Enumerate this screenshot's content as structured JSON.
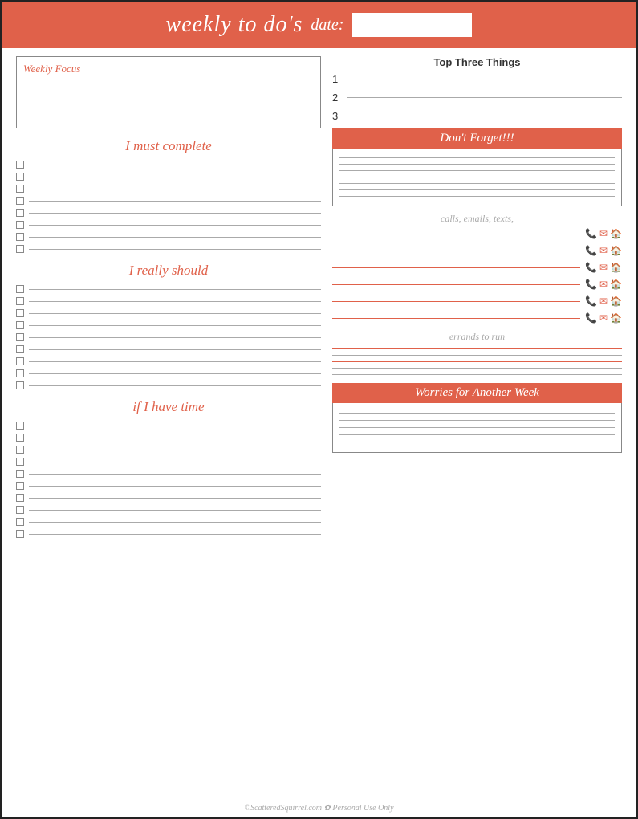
{
  "header": {
    "title": "weekly to do's",
    "date_label": "date:",
    "date_placeholder": ""
  },
  "left": {
    "weekly_focus_label": "Weekly Focus",
    "section1_label": "I must complete",
    "section2_label": "I really should",
    "section3_label": "if I have time",
    "must_complete_count": 8,
    "really_should_count": 9,
    "if_have_time_count": 10
  },
  "right": {
    "top_three_title": "Top Three Things",
    "top_three_items": [
      "1",
      "2",
      "3"
    ],
    "dont_forget_title": "Don't Forget!!!",
    "dont_forget_lines": 7,
    "calls_label": "calls, emails, texts,",
    "calls_rows": 6,
    "errands_label": "errands to run",
    "errand_rows": 5,
    "worries_title": "Worries for Another Week",
    "worries_lines": 5
  },
  "footer": {
    "text": "©ScatteredSquirrel.com ✿ Personal Use Only"
  }
}
